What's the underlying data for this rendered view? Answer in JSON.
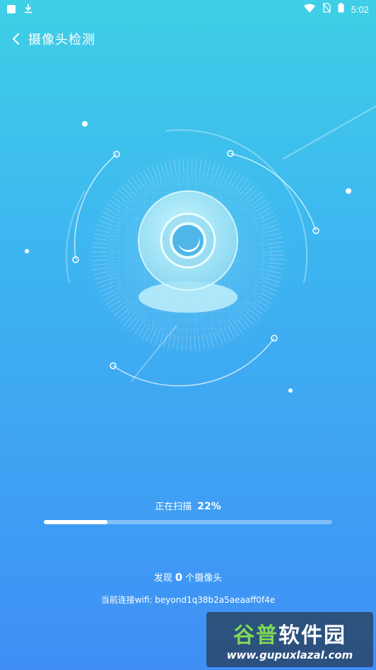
{
  "status_bar": {
    "time": "5:02",
    "icons": [
      "notification-square-icon",
      "download-icon",
      "wifi-icon",
      "no-sim-icon",
      "battery-icon"
    ]
  },
  "header": {
    "back_icon": "chevron-left-icon",
    "title": "摄像头检测"
  },
  "scan": {
    "status_text": "正在扫描",
    "progress_text": "22%",
    "progress": 0.22
  },
  "result": {
    "prefix": "发现",
    "count": "0",
    "suffix": "个摄像头"
  },
  "wifi": {
    "label": "当前连接wifi:",
    "ssid": "beyond1q38b2a5aeaaff0f4e"
  },
  "watermark": {
    "brand_a": "谷普",
    "brand_b": "软件园",
    "url": "www.gupuxlazal.com"
  },
  "colors": {
    "gradient_top": "#3fcfe6",
    "gradient_bottom": "#3f8ff5",
    "accent_white": "#ffffff"
  }
}
